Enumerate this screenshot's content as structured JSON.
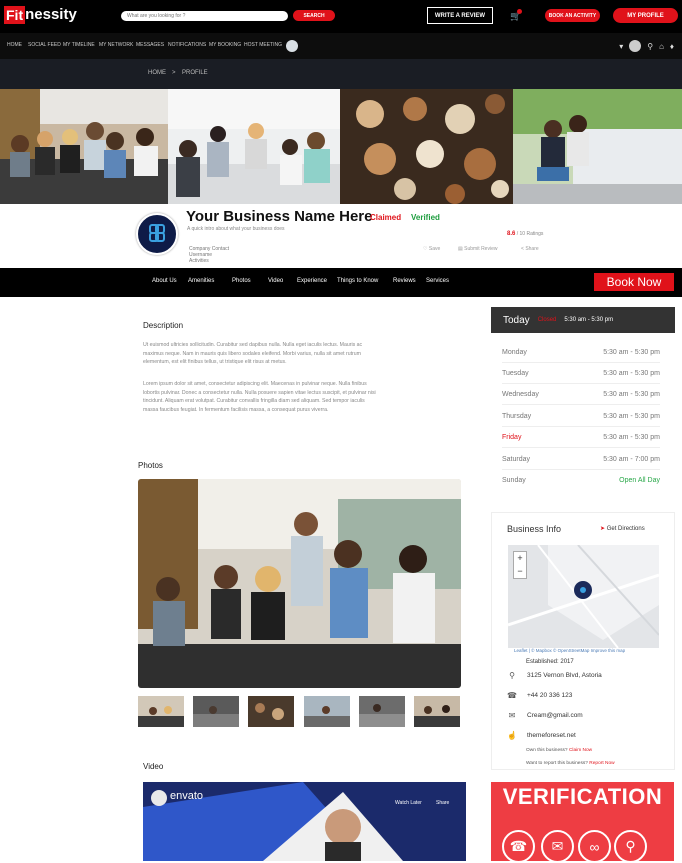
{
  "header": {
    "logo_fit": "Fit",
    "logo_rest": "nessity",
    "search_placeholder": "What are you looking for ?",
    "search_button": "SEARCH",
    "write_review": "WRITE A REVIEW",
    "book_activity": "BOOK AN ACTIVITY",
    "my_profile": "MY PROFILE"
  },
  "nav": {
    "items": [
      "HOME",
      "SOCIAL FEED",
      "MY TIMELINE",
      "MY NETWORK",
      "MESSAGES",
      "NOTIFICATIONS",
      "MY BOOKING",
      "HOST MEETING"
    ]
  },
  "breadcrumb": {
    "home": "HOME",
    "separator": ">",
    "current": "PROFILE"
  },
  "business": {
    "name": "Your Business Name Here",
    "claimed": "Claimed",
    "verified": "Verified",
    "tagline": "A quick intro about what your business does",
    "rating_value": "8.6",
    "rating_text": "/ 10 Ratings",
    "contact": [
      "Company Contact",
      "Username",
      "Activities"
    ],
    "save": "Save",
    "submit_review": "Submit Review",
    "share": "Share"
  },
  "tabs": [
    "About Us",
    "Amenities",
    "Photos",
    "Video",
    "Experience",
    "Things to Know",
    "Reviews",
    "Services"
  ],
  "book_now": "Book Now",
  "description": {
    "heading": "Description",
    "para1": [
      "Ut euismod ultricies sollicitudin. Curabitur sed dapibus nulla. Nulla eget iaculis lectus. Mauris ac",
      "maximus neque. Nam in mauris quis libero sodales eleifend. Morbi varius, nulla sit amet rutrum",
      "elementum, est elit finibus tellus, ut tristique elit risus at metus."
    ],
    "para2": [
      "Lorem ipsum dolor sit amet, consectetur adipiscing elit. Maecenas in pulvinar neque. Nulla finibus",
      "lobortis pulvinar. Donec a consectetur nulla. Nulla posuere sapien vitae lectus suscipit, et pulvinar nisi",
      "tincidunt. Aliquam erat volutpat. Curabitur convallis fringilla diam sed aliquam. Sed tempor iaculis",
      "massa faucibus feugiat. In fermentum facilisis massa, a consequat purus viverra."
    ]
  },
  "hours": {
    "today_label": "Today",
    "today_status": "Closed",
    "today_hours": "5:30 am - 5:30 pm",
    "rows": [
      {
        "day": "Monday",
        "time": "5:30 am - 5:30 pm"
      },
      {
        "day": "Tuesday",
        "time": "5:30 am - 5:30 pm"
      },
      {
        "day": "Wednesday",
        "time": "5:30 am - 5:30 pm"
      },
      {
        "day": "Thursday",
        "time": "5:30 am - 5:30 pm"
      },
      {
        "day": "Friday",
        "time": "5:30 am - 5:30 pm"
      },
      {
        "day": "Saturday",
        "time": "5:30 am - 7:00 pm"
      },
      {
        "day": "Sunday",
        "time": "Open All Day"
      }
    ]
  },
  "photos_heading": "Photos",
  "video_heading": "Video",
  "video": {
    "brand": "envato",
    "watch_later": "Watch Later",
    "share": "Share"
  },
  "business_info": {
    "heading": "Business Info",
    "get_directions": "Get Directions",
    "map_attribution": "Leaflet | © Mapbox © OpenStreetMap Improve this map",
    "established": "Established: 2017",
    "address": "3125 Vernon Blvd, Astoria",
    "phone": "+44 20 336 123",
    "email": "Cream@gmail.com",
    "website": "themeforeset.net",
    "own_text": "Own this business?",
    "own_link": "Claim Now",
    "report_text": "Want to report this business?",
    "report_link": "Report Now"
  },
  "verification": "VERIFICATION",
  "colors": {
    "brand_red": "#e0121a",
    "verified_green": "#1d9d3e",
    "open_green": "#2aa84a"
  }
}
